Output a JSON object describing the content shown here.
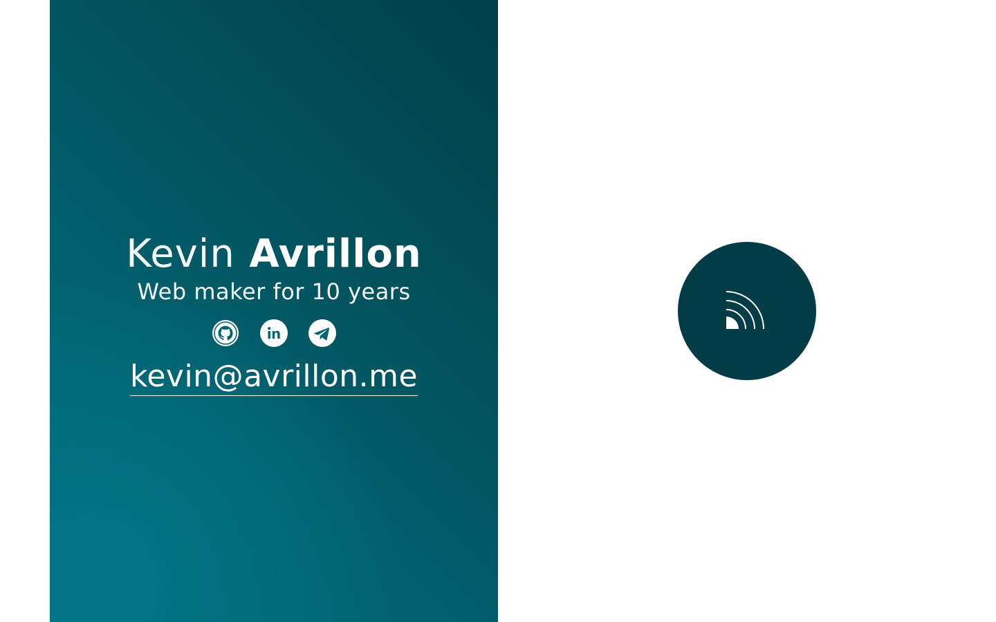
{
  "profile": {
    "first_name": "Kevin",
    "last_name": "Avrillon",
    "tagline": "Web maker for 10 years",
    "email": "kevin@avrillon.me",
    "socials": [
      {
        "icon": "github-icon"
      },
      {
        "icon": "linkedin-icon"
      },
      {
        "icon": "telegram-icon"
      }
    ]
  },
  "feed_button": {
    "icon": "rss-icon"
  },
  "colors": {
    "panel_gradient_start": "#027686",
    "panel_gradient_end": "#024149",
    "feed_button_bg": "#023d47",
    "text": "#ffffff",
    "page_bg": "#ffffff"
  }
}
